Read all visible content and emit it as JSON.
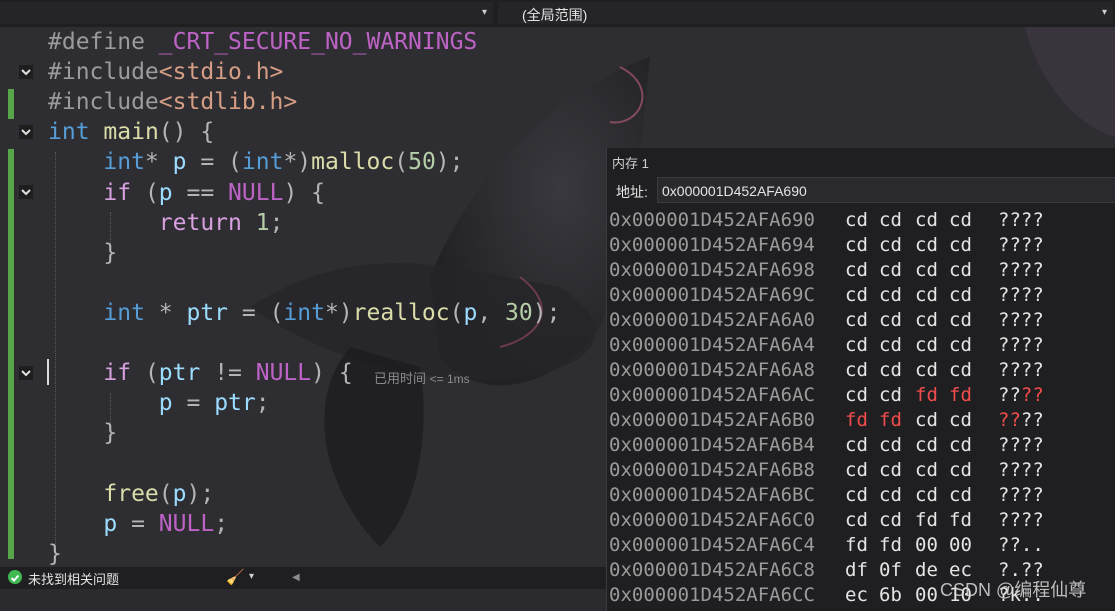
{
  "toolbar": {
    "scope_left": "",
    "scope_right": "(全局范围)"
  },
  "code": [
    {
      "segments": [
        [
          "pre",
          "#define "
        ],
        [
          "mac",
          "_CRT_SECURE_NO_WARNINGS"
        ]
      ]
    },
    {
      "segments": [
        [
          "pre",
          "#include"
        ],
        [
          "str",
          "<stdio.h>"
        ]
      ]
    },
    {
      "segments": [
        [
          "pre",
          "#include"
        ],
        [
          "str",
          "<stdlib.h>"
        ]
      ]
    },
    {
      "segments": [
        [
          "kw",
          "int"
        ],
        [
          "op",
          " "
        ],
        [
          "fn",
          "main"
        ],
        [
          "op",
          "() {"
        ]
      ]
    },
    {
      "segments": [
        [
          "op",
          "    "
        ],
        [
          "kw",
          "int"
        ],
        [
          "op",
          "* "
        ],
        [
          "var",
          "p"
        ],
        [
          "op",
          " = ("
        ],
        [
          "kw",
          "int"
        ],
        [
          "op",
          "*)"
        ],
        [
          "fn",
          "malloc"
        ],
        [
          "op",
          "("
        ],
        [
          "num",
          "50"
        ],
        [
          "op",
          ");"
        ]
      ]
    },
    {
      "segments": [
        [
          "op",
          "    "
        ],
        [
          "kw2",
          "if"
        ],
        [
          "op",
          " ("
        ],
        [
          "var",
          "p"
        ],
        [
          "op",
          " == "
        ],
        [
          "nul",
          "NULL"
        ],
        [
          "op",
          ") {"
        ]
      ]
    },
    {
      "segments": [
        [
          "op",
          "        "
        ],
        [
          "kw2",
          "return"
        ],
        [
          "op",
          " "
        ],
        [
          "num",
          "1"
        ],
        [
          "op",
          ";"
        ]
      ]
    },
    {
      "segments": [
        [
          "op",
          "    }"
        ]
      ]
    },
    {
      "segments": []
    },
    {
      "segments": [
        [
          "op",
          "    "
        ],
        [
          "kw",
          "int"
        ],
        [
          "op",
          " * "
        ],
        [
          "var",
          "ptr"
        ],
        [
          "op",
          " = ("
        ],
        [
          "kw",
          "int"
        ],
        [
          "op",
          "*)"
        ],
        [
          "fn",
          "realloc"
        ],
        [
          "op",
          "("
        ],
        [
          "var",
          "p"
        ],
        [
          "op",
          ", "
        ],
        [
          "num",
          "30"
        ],
        [
          "op",
          ");"
        ]
      ]
    },
    {
      "segments": []
    },
    {
      "segments": [
        [
          "op",
          "    "
        ],
        [
          "kw2",
          "if"
        ],
        [
          "op",
          " ("
        ],
        [
          "var",
          "ptr"
        ],
        [
          "op",
          " != "
        ],
        [
          "nul",
          "NULL"
        ],
        [
          "op",
          ") {"
        ]
      ]
    },
    {
      "segments": [
        [
          "op",
          "        "
        ],
        [
          "var",
          "p"
        ],
        [
          "op",
          " = "
        ],
        [
          "var",
          "ptr"
        ],
        [
          "op",
          ";"
        ]
      ]
    },
    {
      "segments": [
        [
          "op",
          "    }"
        ]
      ]
    },
    {
      "segments": []
    },
    {
      "segments": [
        [
          "op",
          "    "
        ],
        [
          "fn",
          "free"
        ],
        [
          "op",
          "("
        ],
        [
          "var",
          "p"
        ],
        [
          "op",
          ");"
        ]
      ]
    },
    {
      "segments": [
        [
          "op",
          "    "
        ],
        [
          "var",
          "p"
        ],
        [
          "op",
          " = "
        ],
        [
          "nul",
          "NULL"
        ],
        [
          "op",
          ";"
        ]
      ]
    },
    {
      "segments": [
        [
          "op",
          "}"
        ]
      ]
    }
  ],
  "perf_hint": {
    "label": "已用时间",
    "value": "<= 1ms"
  },
  "status": {
    "text": "未找到相关问题"
  },
  "memory": {
    "title": "内存 1",
    "address_label": "地址:",
    "address_value": "0x000001D452AFA690",
    "rows": [
      {
        "addr": "0x000001D452AFA690",
        "bytes": [
          "cd",
          "cd",
          "cd",
          "cd"
        ],
        "chars": "????",
        "red_bytes": [],
        "red_chars": 0
      },
      {
        "addr": "0x000001D452AFA694",
        "bytes": [
          "cd",
          "cd",
          "cd",
          "cd"
        ],
        "chars": "????",
        "red_bytes": [],
        "red_chars": 0
      },
      {
        "addr": "0x000001D452AFA698",
        "bytes": [
          "cd",
          "cd",
          "cd",
          "cd"
        ],
        "chars": "????",
        "red_bytes": [],
        "red_chars": 0
      },
      {
        "addr": "0x000001D452AFA69C",
        "bytes": [
          "cd",
          "cd",
          "cd",
          "cd"
        ],
        "chars": "????",
        "red_bytes": [],
        "red_chars": 0
      },
      {
        "addr": "0x000001D452AFA6A0",
        "bytes": [
          "cd",
          "cd",
          "cd",
          "cd"
        ],
        "chars": "????",
        "red_bytes": [],
        "red_chars": 0
      },
      {
        "addr": "0x000001D452AFA6A4",
        "bytes": [
          "cd",
          "cd",
          "cd",
          "cd"
        ],
        "chars": "????",
        "red_bytes": [],
        "red_chars": 0
      },
      {
        "addr": "0x000001D452AFA6A8",
        "bytes": [
          "cd",
          "cd",
          "cd",
          "cd"
        ],
        "chars": "????",
        "red_bytes": [],
        "red_chars": 0
      },
      {
        "addr": "0x000001D452AFA6AC",
        "bytes": [
          "cd",
          "cd",
          "fd",
          "fd"
        ],
        "chars": "????",
        "red_bytes": [
          2,
          3
        ],
        "red_chars": 2,
        "red_side": "right"
      },
      {
        "addr": "0x000001D452AFA6B0",
        "bytes": [
          "fd",
          "fd",
          "cd",
          "cd"
        ],
        "chars": "????",
        "red_bytes": [
          0,
          1
        ],
        "red_chars": 2,
        "red_side": "left"
      },
      {
        "addr": "0x000001D452AFA6B4",
        "bytes": [
          "cd",
          "cd",
          "cd",
          "cd"
        ],
        "chars": "????",
        "red_bytes": [],
        "red_chars": 0
      },
      {
        "addr": "0x000001D452AFA6B8",
        "bytes": [
          "cd",
          "cd",
          "cd",
          "cd"
        ],
        "chars": "????",
        "red_bytes": [],
        "red_chars": 0
      },
      {
        "addr": "0x000001D452AFA6BC",
        "bytes": [
          "cd",
          "cd",
          "cd",
          "cd"
        ],
        "chars": "????",
        "red_bytes": [],
        "red_chars": 0
      },
      {
        "addr": "0x000001D452AFA6C0",
        "bytes": [
          "cd",
          "cd",
          "fd",
          "fd"
        ],
        "chars": "????",
        "red_bytes": [],
        "red_chars": 0
      },
      {
        "addr": "0x000001D452AFA6C4",
        "bytes": [
          "fd",
          "fd",
          "00",
          "00"
        ],
        "chars": "??..",
        "red_bytes": [],
        "red_chars": 0
      },
      {
        "addr": "0x000001D452AFA6C8",
        "bytes": [
          "df",
          "0f",
          "de",
          "ec"
        ],
        "chars": "?.??",
        "red_bytes": [],
        "red_chars": 0
      },
      {
        "addr": "0x000001D452AFA6CC",
        "bytes": [
          "ec",
          "6b",
          "00",
          "10"
        ],
        "chars": "?k..",
        "red_bytes": [],
        "red_chars": 0
      }
    ]
  },
  "watermark": "CSDN @编程仙尊",
  "colors": {
    "green_change_bar": "#57a64a",
    "changed_value": "#f14c4c",
    "status_ok": "#3fb950"
  },
  "icons": {
    "status": "check-circle-icon",
    "cleanup": "brush-icon",
    "fold": "fold-toggle-icon"
  }
}
